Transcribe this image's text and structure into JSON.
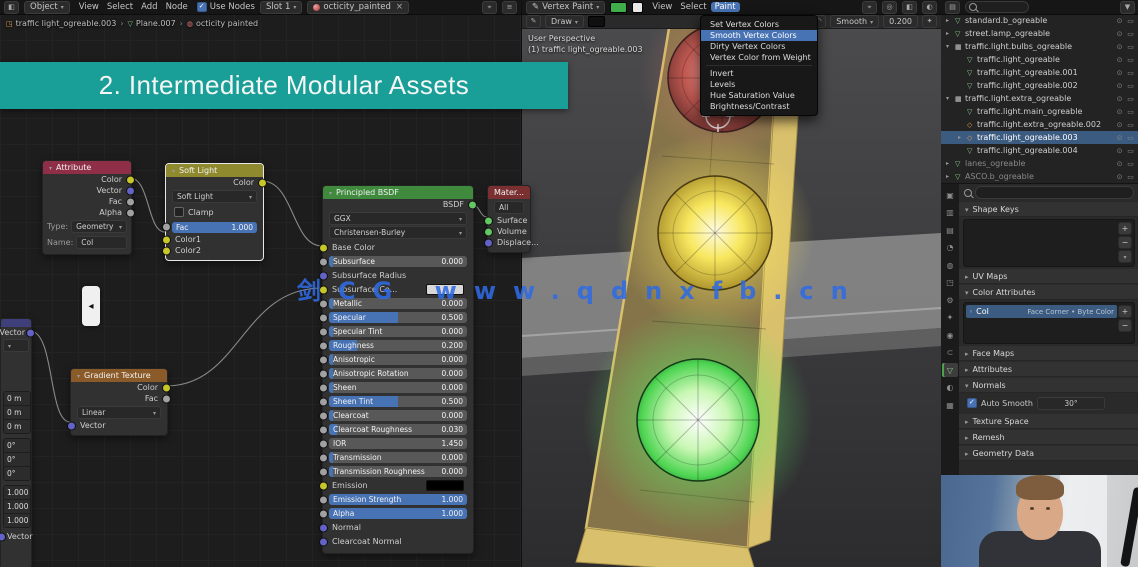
{
  "watermark": {
    "text": "剑CG www.qdnxfb.cn"
  },
  "banner": {
    "title": "2. Intermediate Modular Assets"
  },
  "shader": {
    "header": {
      "shader_type": "Object",
      "menus": [
        "View",
        "Select",
        "Add",
        "Node"
      ],
      "use_nodes": "Use Nodes",
      "slot": "Slot 1",
      "material": "octicity_painted"
    },
    "breadcrumb": [
      "traffic light_ogreable.003",
      "Plane.007",
      "octicity painted"
    ],
    "nodes": {
      "attribute": {
        "title": "Attribute",
        "outputs": [
          {
            "label": "Color",
            "socket": "#c7c729"
          },
          {
            "label": "Vector",
            "socket": "#6363c7"
          },
          {
            "label": "Fac",
            "socket": "#a1a1a1"
          },
          {
            "label": "Alpha",
            "socket": "#a1a1a1"
          }
        ],
        "type_label": "Type:",
        "type_value": "Geometry",
        "name_label": "Name:",
        "name_value": "Col"
      },
      "mix": {
        "title": "Soft Light",
        "output": "Color",
        "mode": "Soft Light",
        "clamp": "Clamp",
        "fac_label": "Fac",
        "fac_value": "1.000",
        "inputs": [
          {
            "label": "Color1",
            "socket": "#c7c729"
          },
          {
            "label": "Color2",
            "socket": "#c7c729"
          }
        ]
      },
      "principled": {
        "title": "Principled BSDF",
        "output": "BSDF",
        "distribution": "GGX",
        "subsurface_method": "Christensen-Burley",
        "rows": [
          {
            "label": "Base Color",
            "is_plain": true,
            "socket": "#c7c729"
          },
          {
            "label": "Subsurface",
            "is_slider": true,
            "value": "0.000",
            "fill": 3,
            "socket": "#a1a1a1"
          },
          {
            "label": "Subsurface Radius",
            "is_plain": true,
            "socket": "#6363c7"
          },
          {
            "label": "Subsurface Co...",
            "is_plain": true,
            "socket": "#c7c729",
            "swatch": "#d8d8d8"
          },
          {
            "label": "Metallic",
            "is_slider": true,
            "value": "0.000",
            "fill": 3,
            "socket": "#a1a1a1"
          },
          {
            "label": "Specular",
            "is_slider": true,
            "value": "0.500",
            "fill": 50,
            "socket": "#a1a1a1"
          },
          {
            "label": "Specular Tint",
            "is_slider": true,
            "value": "0.000",
            "fill": 3,
            "socket": "#a1a1a1"
          },
          {
            "label": "Roughness",
            "is_slider": true,
            "value": "0.200",
            "fill": 20,
            "socket": "#a1a1a1"
          },
          {
            "label": "Anisotropic",
            "is_slider": true,
            "value": "0.000",
            "fill": 3,
            "socket": "#a1a1a1"
          },
          {
            "label": "Anisotropic Rotation",
            "is_slider": true,
            "value": "0.000",
            "fill": 3,
            "socket": "#a1a1a1"
          },
          {
            "label": "Sheen",
            "is_slider": true,
            "value": "0.000",
            "fill": 3,
            "socket": "#a1a1a1"
          },
          {
            "label": "Sheen Tint",
            "is_slider": true,
            "value": "0.500",
            "fill": 50,
            "socket": "#a1a1a1"
          },
          {
            "label": "Clearcoat",
            "is_slider": true,
            "value": "0.000",
            "fill": 3,
            "socket": "#a1a1a1"
          },
          {
            "label": "Clearcoat Roughness",
            "is_slider": true,
            "value": "0.030",
            "fill": 6,
            "socket": "#a1a1a1"
          },
          {
            "label": "IOR",
            "is_slider": true,
            "value": "1.450",
            "fill": 0,
            "socket": "#a1a1a1"
          },
          {
            "label": "Transmission",
            "is_slider": true,
            "value": "0.000",
            "fill": 3,
            "socket": "#a1a1a1"
          },
          {
            "label": "Transmission Roughness",
            "is_slider": true,
            "value": "0.000",
            "fill": 3,
            "socket": "#a1a1a1"
          },
          {
            "label": "Emission",
            "is_plain": true,
            "socket": "#c7c729",
            "swatch": "#000000"
          },
          {
            "label": "Emission Strength",
            "is_slider": true,
            "value": "1.000",
            "fill": 100,
            "socket": "#a1a1a1"
          },
          {
            "label": "Alpha",
            "is_slider": true,
            "value": "1.000",
            "fill": 100,
            "socket": "#a1a1a1"
          },
          {
            "label": "Normal",
            "is_plain": true,
            "socket": "#6363c7"
          },
          {
            "label": "Clearcoat Normal",
            "is_plain": true,
            "socket": "#6363c7"
          }
        ]
      },
      "output": {
        "title": "Mater...",
        "all_label": "All",
        "inputs": [
          {
            "label": "Surface",
            "socket": "#63c763"
          },
          {
            "label": "Volume",
            "socket": "#63c763"
          },
          {
            "label": "Displace...",
            "socket": "#6363c7"
          }
        ]
      },
      "gradient": {
        "title": "Gradient Texture",
        "outputs": [
          {
            "label": "Color",
            "socket": "#c7c729"
          },
          {
            "label": "Fac",
            "socket": "#a1a1a1"
          }
        ],
        "interpolation": "Linear",
        "input": "Vector"
      },
      "mapping": {
        "output": "Vector",
        "input": "Vector",
        "location": [
          "0 m",
          "0 m",
          "0 m"
        ],
        "rotation": [
          "0°",
          "0°",
          "0°"
        ],
        "scale": [
          "1.000",
          "1.000",
          "1.000"
        ]
      }
    }
  },
  "viewport": {
    "mode": "Vertex Paint",
    "menus": [
      {
        "label": "View"
      },
      {
        "label": "Select"
      },
      {
        "label": "Paint",
        "active": true
      }
    ],
    "brush_color": "#3fae4a",
    "tool": {
      "name": "Draw",
      "falloff": "Smooth",
      "strength": "0.200"
    },
    "overlay_lines": [
      "User Perspective",
      "(1) traffic light_ogreable.003"
    ],
    "paint_menu": [
      {
        "label": "Set Vertex Colors"
      },
      {
        "label": "Smooth Vertex Colors",
        "highlight": true
      },
      {
        "label": "Dirty Vertex Colors"
      },
      {
        "label": "Vertex Color from Weight",
        "sep_after": true
      },
      {
        "label": "Invert"
      },
      {
        "label": "Levels"
      },
      {
        "label": "Hue Saturation Value"
      },
      {
        "label": "Brightness/Contrast"
      }
    ]
  },
  "outliner": {
    "rows": [
      {
        "pad": 2,
        "expander": "▸",
        "icon": "▽",
        "icon_color": "#8fce8f",
        "name": "standard.b_ogreable"
      },
      {
        "pad": 2,
        "expander": "▸",
        "icon": "▽",
        "icon_color": "#8fce8f",
        "name": "street.lamp_ogreable"
      },
      {
        "pad": 2,
        "expander": "▾",
        "icon": "▦",
        "icon_color": "#cfcfcf",
        "name": "traffic.light.bulbs_ogreable"
      },
      {
        "pad": 14,
        "expander": "",
        "icon": "▽",
        "icon_color": "#8fce8f",
        "name": "traffic.light_ogreable"
      },
      {
        "pad": 14,
        "expander": "",
        "icon": "▽",
        "icon_color": "#8fce8f",
        "name": "traffic.light_ogreable.001"
      },
      {
        "pad": 14,
        "expander": "",
        "icon": "▽",
        "icon_color": "#8fce8f",
        "name": "traffic.light_ogreable.002"
      },
      {
        "pad": 2,
        "expander": "▾",
        "icon": "▦",
        "icon_color": "#cfcfcf",
        "name": "traffic.light.extra_ogreable"
      },
      {
        "pad": 14,
        "expander": "",
        "icon": "▽",
        "icon_color": "#8fce8f",
        "name": "traffic.light.main_ogreable"
      },
      {
        "pad": 14,
        "expander": "",
        "icon": "◇",
        "icon_color": "#e8a15a",
        "name": "traffic.light.extra_ogreable.002"
      },
      {
        "pad": 14,
        "expander": "▸",
        "icon": "◇",
        "icon_color": "#e8a15a",
        "name": "traffic.light_ogreable.003",
        "selected": true
      },
      {
        "pad": 14,
        "expander": "",
        "icon": "▽",
        "icon_color": "#8fce8f",
        "name": "traffic.light_ogreable.004"
      },
      {
        "pad": 2,
        "expander": "▸",
        "icon": "▽",
        "icon_color": "#8fce8f",
        "name": "lanes_ogreable",
        "dim": true
      },
      {
        "pad": 2,
        "expander": "▸",
        "icon": "▽",
        "icon_color": "#8fce8f",
        "name": "ASCO.b_ogreable",
        "dim": true
      }
    ]
  },
  "properties": {
    "tabs": [
      {
        "glyph": "▣",
        "name": "render"
      },
      {
        "glyph": "▥",
        "name": "output"
      },
      {
        "glyph": "▤",
        "name": "view-layer"
      },
      {
        "glyph": "◔",
        "name": "scene"
      },
      {
        "glyph": "◍",
        "name": "world"
      },
      {
        "glyph": "◳",
        "name": "object"
      },
      {
        "glyph": "⚙",
        "name": "modifiers"
      },
      {
        "glyph": "✦",
        "name": "particles"
      },
      {
        "glyph": "◉",
        "name": "physics"
      },
      {
        "glyph": "⊂",
        "name": "constraints"
      },
      {
        "glyph": "▽",
        "name": "object-data",
        "active": true
      },
      {
        "glyph": "◐",
        "name": "material"
      },
      {
        "glyph": "▦",
        "name": "texture"
      }
    ],
    "panels": {
      "shape_keys": "Shape Keys",
      "uv_maps": "UV Maps",
      "color_attributes": "Color Attributes",
      "face_maps": "Face Maps",
      "attributes": "Attributes",
      "normals": "Normals",
      "texture_space": "Texture Space",
      "remesh": "Remesh",
      "geometry_data": "Geometry Data"
    },
    "color_attribute": {
      "name": "Col",
      "detail": "Face Corner • Byte Color"
    },
    "normals": {
      "auto_smooth": "Auto Smooth",
      "angle": "30°"
    }
  }
}
